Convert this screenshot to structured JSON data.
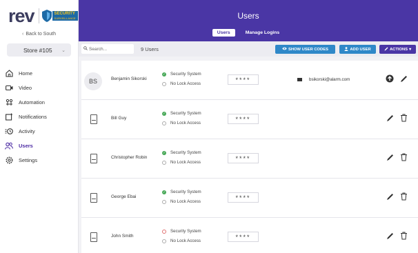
{
  "brand": {
    "name": "rev",
    "badge_main": "SECURITY",
    "badge_sub": "SURVEILLANCE"
  },
  "sidebar": {
    "back_label": "Back to South",
    "store_label": "Store #105",
    "items": [
      {
        "label": "Home",
        "icon": "home-icon",
        "active": false
      },
      {
        "label": "Video",
        "icon": "video-icon",
        "active": false
      },
      {
        "label": "Automation",
        "icon": "automation-icon",
        "active": false
      },
      {
        "label": "Notifications",
        "icon": "notifications-icon",
        "active": false
      },
      {
        "label": "Activity",
        "icon": "activity-icon",
        "active": false
      },
      {
        "label": "Users",
        "icon": "users-icon",
        "active": true
      },
      {
        "label": "Settings",
        "icon": "settings-icon",
        "active": false
      }
    ]
  },
  "header": {
    "title": "Users",
    "tabs": [
      {
        "label": "Users",
        "active": true
      },
      {
        "label": "Manage Logins",
        "active": false
      }
    ]
  },
  "toolbar": {
    "search_placeholder": "Search...",
    "user_count": "9 Users",
    "show_codes_label": "SHOW USER CODES",
    "add_user_label": "ADD USER",
    "actions_label": "ACTIONS"
  },
  "users": [
    {
      "name": "Benjamin Sikorski",
      "initials": "BS",
      "access1": "Security System",
      "access1_status": "ok",
      "access2": "No Lock Access",
      "code": "****",
      "email": "bsikorski@alarm.com",
      "actions": [
        "upload-icon",
        "edit-icon"
      ]
    },
    {
      "name": "Bill Guy",
      "initials": "",
      "access1": "Security System",
      "access1_status": "ok",
      "access2": "No Lock Access",
      "code": "****",
      "email": "",
      "actions": [
        "edit-icon",
        "delete-icon"
      ]
    },
    {
      "name": "Christopher Robin",
      "initials": "",
      "access1": "Security System",
      "access1_status": "ok",
      "access2": "No Lock Access",
      "code": "****",
      "email": "",
      "actions": [
        "edit-icon",
        "delete-icon"
      ]
    },
    {
      "name": "George Ebai",
      "initials": "",
      "access1": "Security System",
      "access1_status": "ok",
      "access2": "No Lock Access",
      "code": "****",
      "email": "",
      "actions": [
        "edit-icon",
        "delete-icon"
      ]
    },
    {
      "name": "John Smith",
      "initials": "",
      "access1": "Security System",
      "access1_status": "error",
      "access2": "No Lock Access",
      "code": "****",
      "email": "",
      "actions": [
        "edit-icon",
        "delete-icon"
      ]
    }
  ],
  "colors": {
    "brand_purple": "#4a36a5",
    "button_blue": "#2f88c8",
    "status_green": "#47a857",
    "status_red": "#e07070"
  }
}
